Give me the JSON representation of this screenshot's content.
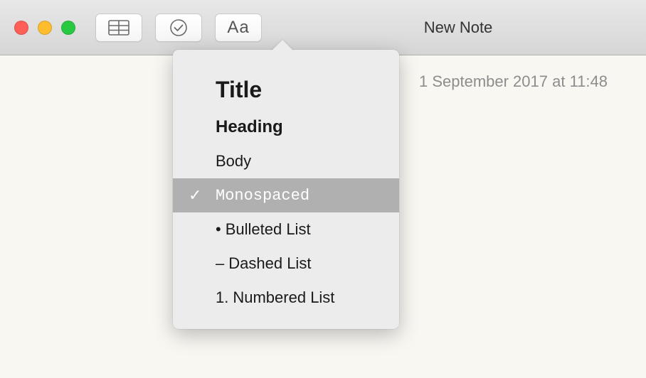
{
  "window": {
    "title": "New Note"
  },
  "toolbar": {
    "format_icon_text": "Aa"
  },
  "note": {
    "timestamp": "1 September 2017 at 11:48"
  },
  "format_menu": {
    "items": [
      {
        "label": "Title",
        "style": "title",
        "selected": false
      },
      {
        "label": "Heading",
        "style": "heading",
        "selected": false
      },
      {
        "label": "Body",
        "style": "body",
        "selected": false
      },
      {
        "label": "Monospaced",
        "style": "monospaced",
        "selected": true
      },
      {
        "label": "Bulleted List",
        "style": "list",
        "prefix": "•",
        "selected": false
      },
      {
        "label": "Dashed List",
        "style": "list",
        "prefix": "–",
        "selected": false
      },
      {
        "label": "Numbered List",
        "style": "list",
        "prefix": "1.",
        "selected": false
      }
    ],
    "checkmark": "✓"
  }
}
